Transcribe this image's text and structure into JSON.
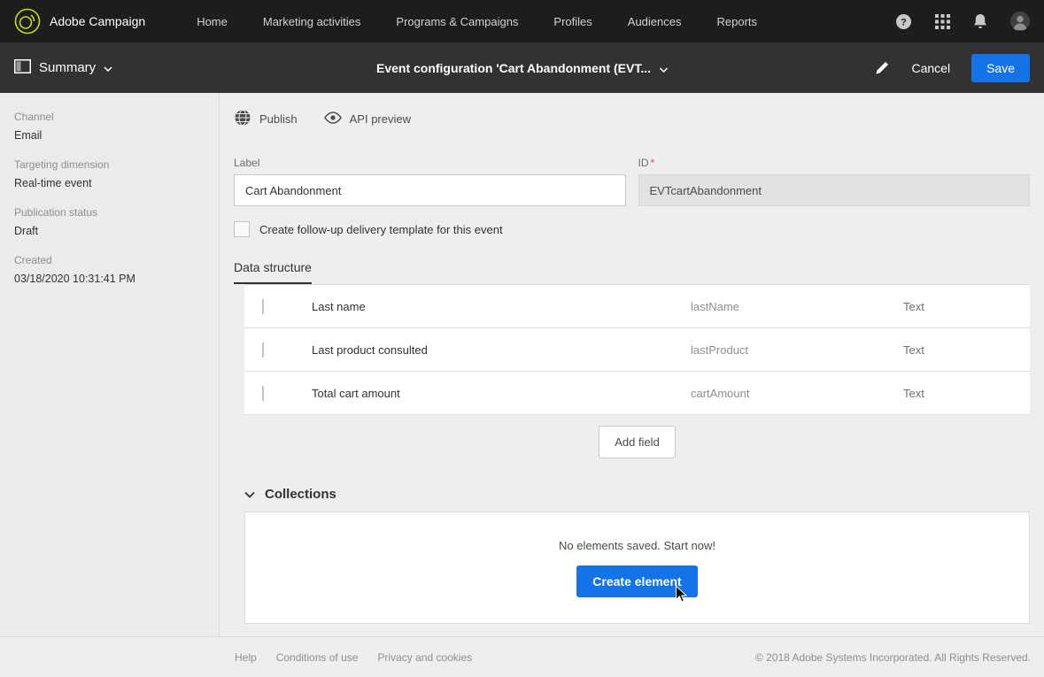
{
  "colors": {
    "accent": "#1473e6",
    "topnav_bg": "#1d1d1d",
    "header_bg": "#323232"
  },
  "topnav": {
    "brand": "Adobe Campaign",
    "items": [
      {
        "label": "Home"
      },
      {
        "label": "Marketing activities"
      },
      {
        "label": "Programs & Campaigns"
      },
      {
        "label": "Profiles"
      },
      {
        "label": "Audiences"
      },
      {
        "label": "Reports"
      }
    ],
    "icons": {
      "help": "help-icon",
      "apps": "apps-grid-icon",
      "notifications": "bell-icon",
      "profile": "avatar"
    }
  },
  "header": {
    "view_label": "Summary",
    "title": "Event configuration 'Cart Abandonment (EVT...",
    "cancel_label": "Cancel",
    "save_label": "Save"
  },
  "sidebar": {
    "fields": [
      {
        "label": "Channel",
        "value": "Email"
      },
      {
        "label": "Targeting dimension",
        "value": "Real-time event"
      },
      {
        "label": "Publication status",
        "value": "Draft"
      },
      {
        "label": "Created",
        "value": "03/18/2020 10:31:41 PM"
      }
    ]
  },
  "toolbar": {
    "publish_label": "Publish",
    "api_preview_label": "API preview"
  },
  "form": {
    "label_field": {
      "label": "Label",
      "value": "Cart Abandonment"
    },
    "id_field": {
      "label": "ID",
      "required_marker": "*",
      "value": "EVTcartAbandonment"
    },
    "followup_checkbox_label": "Create follow-up delivery template for this event"
  },
  "tabs": {
    "data_structure": "Data structure"
  },
  "fields_table": {
    "rows": [
      {
        "name": "Last name",
        "id": "lastName",
        "type": "Text"
      },
      {
        "name": "Last product consulted",
        "id": "lastProduct",
        "type": "Text"
      },
      {
        "name": "Total cart amount",
        "id": "cartAmount",
        "type": "Text"
      }
    ],
    "add_field_label": "Add field"
  },
  "collections": {
    "title": "Collections",
    "empty_message": "No elements saved. Start now!",
    "create_button_label": "Create element"
  },
  "footer": {
    "links": [
      {
        "label": "Help"
      },
      {
        "label": "Conditions of use"
      },
      {
        "label": "Privacy and cookies"
      }
    ],
    "copyright": "© 2018 Adobe Systems Incorporated. All Rights Reserved."
  }
}
